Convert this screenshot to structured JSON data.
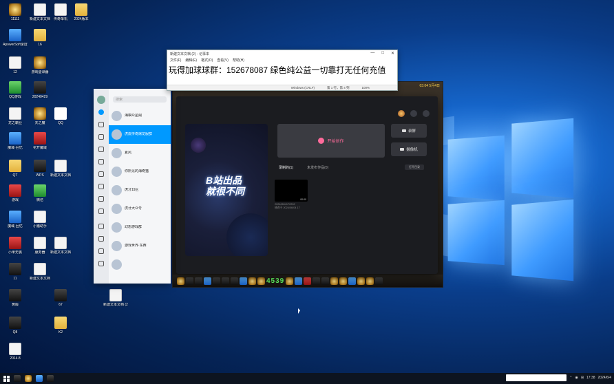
{
  "notepad": {
    "title": "新建文本文档 (2) - 记事本",
    "menu": [
      "文件(F)",
      "编辑(E)",
      "格式(O)",
      "查看(V)",
      "帮助(H)"
    ],
    "text": "玩得加球球群：152678087  绿色纯公益一切靠打无任何充值",
    "status": [
      "Windows (CRLF)",
      "第 1 行，第 4 列",
      "100%"
    ]
  },
  "qq": {
    "search_placeholder": "搜索",
    "chats": [
      {
        "name": "海棋众星阁",
        "sub": "",
        "time": ""
      },
      {
        "name": "虎皮传奇屠龙服群",
        "sub": "",
        "time": ""
      },
      {
        "name": "夏风",
        "sub": "",
        "time": ""
      },
      {
        "name": "你所见的海奇猫",
        "sub": "",
        "time": ""
      },
      {
        "name": "虎牙19区",
        "sub": "",
        "time": ""
      },
      {
        "name": "虎牙大众号",
        "sub": "",
        "time": ""
      },
      {
        "name": "幻想游戏群",
        "sub": "",
        "time": ""
      },
      {
        "name": "游戏世界·东西",
        "sub": "",
        "time": ""
      },
      {
        "name": "",
        "sub": "",
        "time": ""
      }
    ]
  },
  "recorder": {
    "slogan_line1": "B站出品",
    "slogan_line2": "就很不同",
    "start_label": "开始创作",
    "btn_record": "录屏",
    "btn_camera": "摄像机",
    "tab_records": "录制的(1)",
    "tab_pending": "未发布作品(0)",
    "open_folder": "打开目录",
    "thumb_duration": "00:00",
    "thumb_name": "20240604172202",
    "thumb_date": "修改于 2024/06/04 17"
  },
  "game": {
    "numbers": "4539",
    "hud": "03:04 5月4日"
  },
  "desktop_icons": [
    {
      "label": "11111",
      "type": "game"
    },
    {
      "label": "新建文本文档",
      "type": "doc"
    },
    {
      "label": "传奇单机",
      "type": "doc"
    },
    {
      "label": "2024版本",
      "type": "folder"
    },
    {
      "label": "ApowerSoft录屏",
      "type": "blue"
    },
    {
      "label": "16",
      "type": "folder"
    },
    {
      "label": "12",
      "type": "doc"
    },
    {
      "label": "游戏登录器",
      "type": "game"
    },
    {
      "label": "QQ游戏",
      "type": "green"
    },
    {
      "label": "20240429",
      "type": "dark"
    },
    {
      "label": "龙之霸业",
      "type": "doc"
    },
    {
      "label": "天之魔",
      "type": "game"
    },
    {
      "label": "QQ",
      "type": "qq"
    },
    {
      "label": "魔域·回忆",
      "type": "blue"
    },
    {
      "label": "花开魔域",
      "type": "red"
    },
    {
      "label": "QT",
      "type": "folder"
    },
    {
      "label": "WPS",
      "type": "dark"
    },
    {
      "label": "新建文本文档",
      "type": "doc"
    },
    {
      "label": "游戏",
      "type": "red"
    },
    {
      "label": "微信",
      "type": "green"
    },
    {
      "label": "魔域·回忆",
      "type": "blue"
    },
    {
      "label": "小猪助手",
      "type": "doc"
    },
    {
      "label": "小米无畏",
      "type": "red"
    },
    {
      "label": "服务器",
      "type": "doc"
    },
    {
      "label": "新建文本文档",
      "type": "doc"
    },
    {
      "label": "11",
      "type": "dark"
    },
    {
      "label": "新建文本文档",
      "type": "doc"
    },
    {
      "label": "黄版",
      "type": "dark"
    },
    {
      "label": "67",
      "type": "dark"
    },
    {
      "label": "新建文本文档 (2)",
      "type": "doc"
    },
    {
      "label": "Q8",
      "type": "dark"
    },
    {
      "label": "K2",
      "type": "folder"
    },
    {
      "label": "2014.8",
      "type": "doc"
    }
  ],
  "taskbar": {
    "time": "17:38",
    "date": "2024/6/4"
  }
}
